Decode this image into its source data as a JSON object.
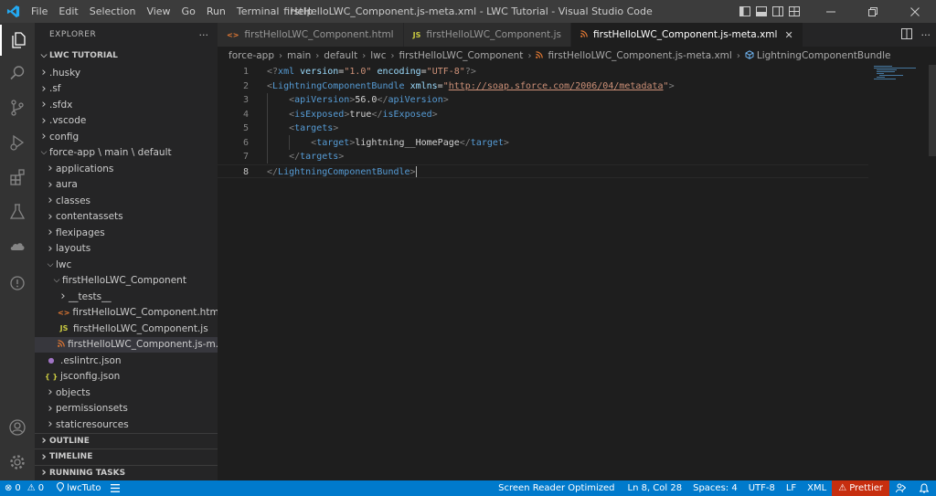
{
  "window": {
    "title": "firstHelloLWC_Component.js-meta.xml - LWC Tutorial - Visual Studio Code"
  },
  "menu": [
    "File",
    "Edit",
    "Selection",
    "View",
    "Go",
    "Run",
    "Terminal",
    "Help"
  ],
  "sidebar": {
    "header": "EXPLORER",
    "more": "···",
    "root": "LWC TUTORIAL",
    "tree": [
      {
        "label": ".husky",
        "depth": 1,
        "kind": "folder",
        "open": false
      },
      {
        "label": ".sf",
        "depth": 1,
        "kind": "folder",
        "open": false
      },
      {
        "label": ".sfdx",
        "depth": 1,
        "kind": "folder",
        "open": false
      },
      {
        "label": ".vscode",
        "depth": 1,
        "kind": "folder",
        "open": false
      },
      {
        "label": "config",
        "depth": 1,
        "kind": "folder",
        "open": false
      },
      {
        "label": "force-app \\ main \\ default",
        "depth": 1,
        "kind": "folder",
        "open": true
      },
      {
        "label": "applications",
        "depth": 2,
        "kind": "folder",
        "open": false
      },
      {
        "label": "aura",
        "depth": 2,
        "kind": "folder",
        "open": false
      },
      {
        "label": "classes",
        "depth": 2,
        "kind": "folder",
        "open": false
      },
      {
        "label": "contentassets",
        "depth": 2,
        "kind": "folder",
        "open": false
      },
      {
        "label": "flexipages",
        "depth": 2,
        "kind": "folder",
        "open": false
      },
      {
        "label": "layouts",
        "depth": 2,
        "kind": "folder",
        "open": false
      },
      {
        "label": "lwc",
        "depth": 2,
        "kind": "folder",
        "open": true
      },
      {
        "label": "firstHelloLWC_Component",
        "depth": 3,
        "kind": "folder",
        "open": true
      },
      {
        "label": "__tests__",
        "depth": 4,
        "kind": "folder",
        "open": false
      },
      {
        "label": "firstHelloLWC_Component.html",
        "depth": 4,
        "kind": "html"
      },
      {
        "label": "firstHelloLWC_Component.js",
        "depth": 4,
        "kind": "js"
      },
      {
        "label": "firstHelloLWC_Component.js-m...",
        "depth": 4,
        "kind": "xml",
        "selected": true
      },
      {
        "label": ".eslintrc.json",
        "depth": 2,
        "kind": "eslint"
      },
      {
        "label": "jsconfig.json",
        "depth": 2,
        "kind": "json"
      },
      {
        "label": "objects",
        "depth": 2,
        "kind": "folder",
        "open": false
      },
      {
        "label": "permissionsets",
        "depth": 2,
        "kind": "folder",
        "open": false
      },
      {
        "label": "staticresources",
        "depth": 2,
        "kind": "folder",
        "open": false
      }
    ],
    "sections": [
      "OUTLINE",
      "TIMELINE",
      "RUNNING TASKS"
    ]
  },
  "tabs": [
    {
      "label": "firstHelloLWC_Component.html",
      "icon": "<>",
      "iconColor": "#e37933",
      "active": false
    },
    {
      "label": "firstHelloLWC_Component.js",
      "icon": "JS",
      "iconColor": "#cbcb41",
      "active": false
    },
    {
      "label": "firstHelloLWC_Component.js-meta.xml",
      "icon": "rss-icon",
      "iconColor": "#e37933",
      "active": true,
      "close": "✕"
    }
  ],
  "breadcrumb": [
    "force-app",
    "main",
    "default",
    "lwc",
    "firstHelloLWC_Component",
    "firstHelloLWC_Component.js-meta.xml",
    "LightningComponentBundle"
  ],
  "code": {
    "line_numbers": [
      "1",
      "2",
      "3",
      "4",
      "5",
      "6",
      "7",
      "8"
    ],
    "current_line": 8,
    "lines": [
      {
        "indent": "",
        "tokens": [
          [
            "t-b",
            "<?"
          ],
          [
            "t-tag",
            "xml"
          ],
          [
            "t-txt",
            " "
          ],
          [
            "t-attr",
            "version"
          ],
          [
            "t-txt",
            "="
          ],
          [
            "t-str",
            "\"1.0\""
          ],
          [
            "t-txt",
            " "
          ],
          [
            "t-attr",
            "encoding"
          ],
          [
            "t-txt",
            "="
          ],
          [
            "t-str",
            "\"UTF-8\""
          ],
          [
            "t-b",
            "?>"
          ]
        ]
      },
      {
        "indent": "",
        "tokens": [
          [
            "t-b",
            "<"
          ],
          [
            "t-tag",
            "LightningComponentBundle"
          ],
          [
            "t-txt",
            " "
          ],
          [
            "t-attr",
            "xmlns"
          ],
          [
            "t-txt",
            "="
          ],
          [
            "t-str",
            "\""
          ],
          [
            "t-link",
            "http://soap.sforce.com/2006/04/metadata"
          ],
          [
            "t-str",
            "\""
          ],
          [
            "t-b",
            ">"
          ]
        ]
      },
      {
        "indent": "    ",
        "tokens": [
          [
            "t-b",
            "<"
          ],
          [
            "t-tag",
            "apiVersion"
          ],
          [
            "t-b",
            ">"
          ],
          [
            "t-txt",
            "56.0"
          ],
          [
            "t-b",
            "</"
          ],
          [
            "t-tag",
            "apiVersion"
          ],
          [
            "t-b",
            ">"
          ]
        ]
      },
      {
        "indent": "    ",
        "tokens": [
          [
            "t-b",
            "<"
          ],
          [
            "t-tag",
            "isExposed"
          ],
          [
            "t-b",
            ">"
          ],
          [
            "t-txt",
            "true"
          ],
          [
            "t-b",
            "</"
          ],
          [
            "t-tag",
            "isExposed"
          ],
          [
            "t-b",
            ">"
          ]
        ]
      },
      {
        "indent": "    ",
        "tokens": [
          [
            "t-b",
            "<"
          ],
          [
            "t-tag",
            "targets"
          ],
          [
            "t-b",
            ">"
          ]
        ]
      },
      {
        "indent": "        ",
        "tokens": [
          [
            "t-b",
            "<"
          ],
          [
            "t-tag",
            "target"
          ],
          [
            "t-b",
            ">"
          ],
          [
            "t-txt",
            "lightning__HomePage"
          ],
          [
            "t-b",
            "</"
          ],
          [
            "t-tag",
            "target"
          ],
          [
            "t-b",
            ">"
          ]
        ]
      },
      {
        "indent": "    ",
        "tokens": [
          [
            "t-b",
            "</"
          ],
          [
            "t-tag",
            "targets"
          ],
          [
            "t-b",
            ">"
          ]
        ]
      },
      {
        "indent": "",
        "tokens": [
          [
            "t-b",
            "</"
          ],
          [
            "t-tag",
            "LightningComponentBundle"
          ],
          [
            "t-b",
            ">"
          ]
        ]
      }
    ]
  },
  "status": {
    "errors": "0",
    "warnings": "0",
    "project": "lwcTuto",
    "screen_reader": "Screen Reader Optimized",
    "position": "Ln 8, Col 28",
    "spaces": "Spaces: 4",
    "encoding": "UTF-8",
    "eol": "LF",
    "language": "XML",
    "prettier": "Prettier"
  },
  "colors": {
    "accent": "#007acc",
    "prettier": "#c72e0f",
    "tab_active": "#1e1e1e"
  }
}
